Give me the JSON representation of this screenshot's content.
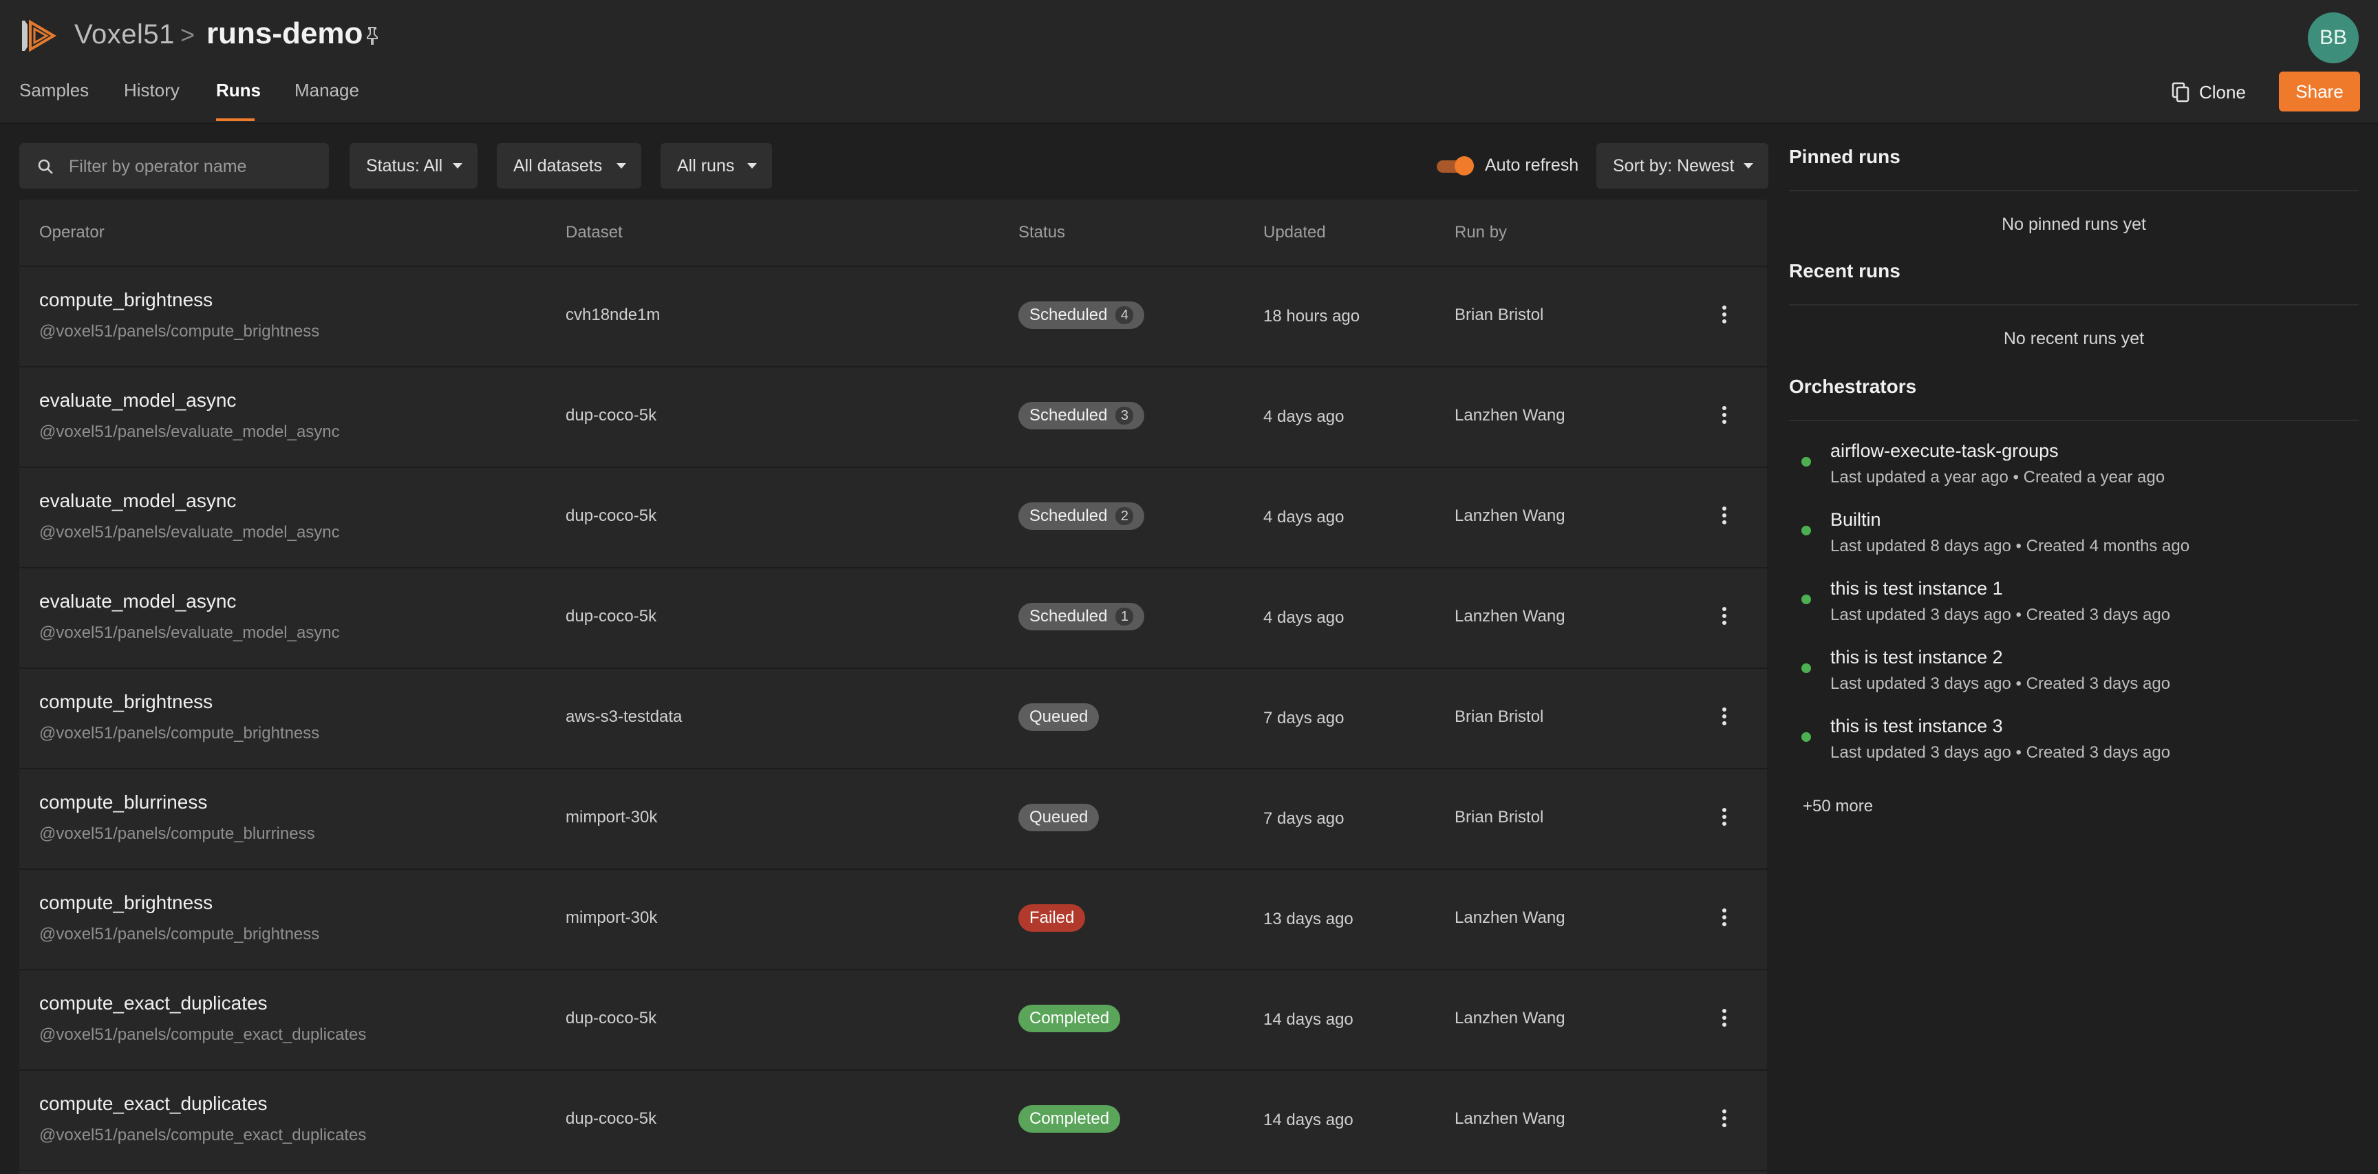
{
  "header": {
    "brand": "Voxel51",
    "separator": ">",
    "dataset": "runs-demo",
    "avatar_initials": "BB",
    "tabs": [
      {
        "label": "Samples"
      },
      {
        "label": "History"
      },
      {
        "label": "Runs"
      },
      {
        "label": "Manage"
      }
    ],
    "active_tab": "Runs",
    "clone_label": "Clone",
    "share_label": "Share"
  },
  "filters": {
    "search_placeholder": "Filter by operator name",
    "status": "Status: All",
    "datasets": "All datasets",
    "runs": "All runs",
    "auto_refresh_label": "Auto refresh",
    "auto_refresh_on": true,
    "sort": "Sort by: Newest"
  },
  "table": {
    "columns": [
      "Operator",
      "Dataset",
      "Status",
      "Updated",
      "Run by"
    ],
    "rows": [
      {
        "operator": "compute_brightness",
        "path": "@voxel51/panels/compute_brightness",
        "dataset": "cvh18nde1m",
        "status": "Scheduled",
        "count": "4",
        "updated": "18 hours ago",
        "run_by": "Brian Bristol"
      },
      {
        "operator": "evaluate_model_async",
        "path": "@voxel51/panels/evaluate_model_async",
        "dataset": "dup-coco-5k",
        "status": "Scheduled",
        "count": "3",
        "updated": "4 days ago",
        "run_by": "Lanzhen Wang"
      },
      {
        "operator": "evaluate_model_async",
        "path": "@voxel51/panels/evaluate_model_async",
        "dataset": "dup-coco-5k",
        "status": "Scheduled",
        "count": "2",
        "updated": "4 days ago",
        "run_by": "Lanzhen Wang"
      },
      {
        "operator": "evaluate_model_async",
        "path": "@voxel51/panels/evaluate_model_async",
        "dataset": "dup-coco-5k",
        "status": "Scheduled",
        "count": "1",
        "updated": "4 days ago",
        "run_by": "Lanzhen Wang"
      },
      {
        "operator": "compute_brightness",
        "path": "@voxel51/panels/compute_brightness",
        "dataset": "aws-s3-testdata",
        "status": "Queued",
        "count": "",
        "updated": "7 days ago",
        "run_by": "Brian Bristol"
      },
      {
        "operator": "compute_blurriness",
        "path": "@voxel51/panels/compute_blurriness",
        "dataset": "mimport-30k",
        "status": "Queued",
        "count": "",
        "updated": "7 days ago",
        "run_by": "Brian Bristol"
      },
      {
        "operator": "compute_brightness",
        "path": "@voxel51/panels/compute_brightness",
        "dataset": "mimport-30k",
        "status": "Failed",
        "count": "",
        "updated": "13 days ago",
        "run_by": "Lanzhen Wang"
      },
      {
        "operator": "compute_exact_duplicates",
        "path": "@voxel51/panels/compute_exact_duplicates",
        "dataset": "dup-coco-5k",
        "status": "Completed",
        "count": "",
        "updated": "14 days ago",
        "run_by": "Lanzhen Wang"
      },
      {
        "operator": "compute_exact_duplicates",
        "path": "@voxel51/panels/compute_exact_duplicates",
        "dataset": "dup-coco-5k",
        "status": "Completed",
        "count": "",
        "updated": "14 days ago",
        "run_by": "Lanzhen Wang"
      }
    ]
  },
  "side": {
    "pinned_title": "Pinned runs",
    "pinned_empty": "No pinned runs yet",
    "recent_title": "Recent runs",
    "recent_empty": "No recent runs yet",
    "orchestrators_title": "Orchestrators",
    "orchestrators": [
      {
        "name": "airflow-execute-task-groups",
        "meta": "Last updated a year ago  •  Created a year ago"
      },
      {
        "name": "Builtin",
        "meta": "Last updated 8 days ago  •  Created 4 months ago"
      },
      {
        "name": "this is test instance 1",
        "meta": "Last updated 3 days ago  •  Created 3 days ago"
      },
      {
        "name": "this is test instance 2",
        "meta": "Last updated 3 days ago  •  Created 3 days ago"
      },
      {
        "name": "this is test instance 3",
        "meta": "Last updated 3 days ago  •  Created 3 days ago"
      }
    ],
    "more_label": "+50 more"
  },
  "colors": {
    "accent": "#ef7a2c",
    "status_scheduled": "#5a5a5a",
    "status_queued": "#5e5e5e",
    "status_failed": "#b23a2c",
    "status_completed": "#5aa55a",
    "orchestrator_online": "#4caf50"
  },
  "icons": {
    "logo": "voxel51-logo-icon",
    "pin": "pin-icon",
    "clone": "copy-icon",
    "search": "search-icon",
    "row_menu": "more-vert-icon"
  }
}
